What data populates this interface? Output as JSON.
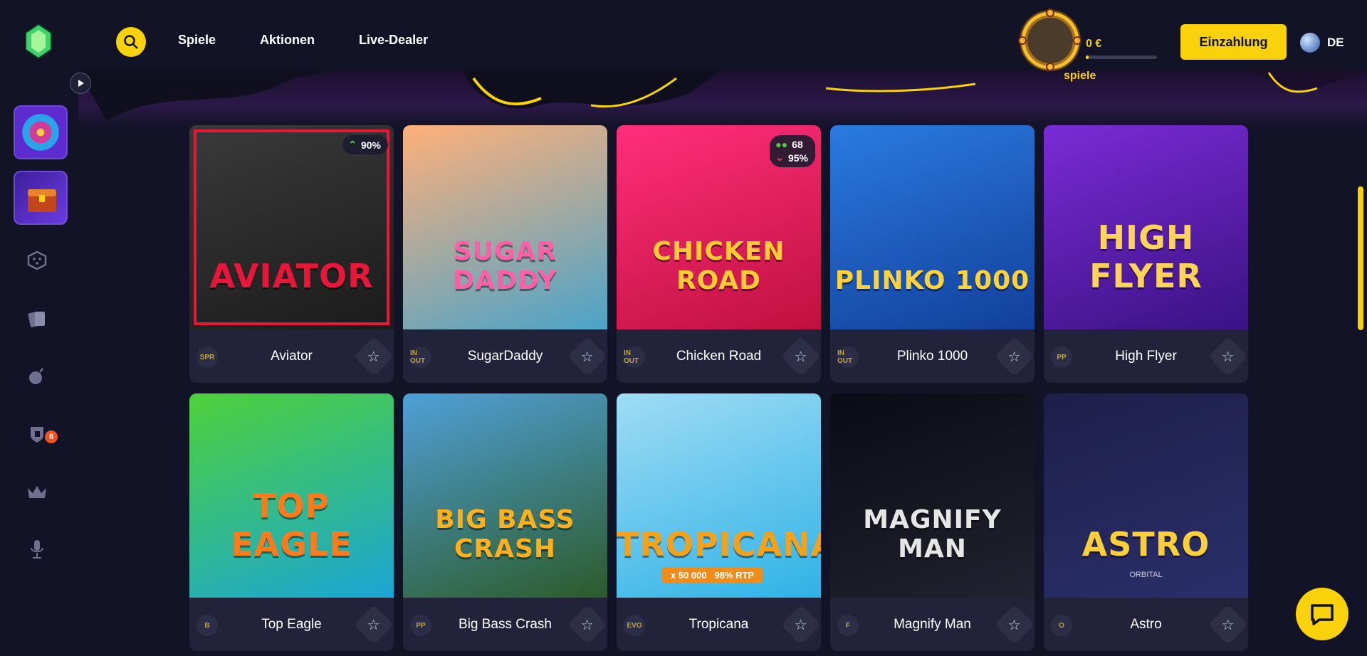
{
  "header": {
    "nav": [
      "Spiele",
      "Aktionen",
      "Live-Dealer"
    ],
    "balance": "0 €",
    "balance_progress": 0.04,
    "deposit_label": "Einzahlung",
    "language": "DE"
  },
  "sidebar": {
    "icons": [
      "wheel-of-fortune-tile",
      "treasure-chest-tile",
      "dice-icon",
      "cards-icon",
      "bomb-icon",
      "shield-icon",
      "crown-icon",
      "microphone-icon"
    ],
    "bomb_badge": "6"
  },
  "banner": {
    "partial_label": "spiele"
  },
  "games": [
    {
      "name": "Aviator",
      "provider": "SPR",
      "rtp": "90%",
      "art": "AVIATOR",
      "colors": [
        "#3a3a3a",
        "#1b1b1b"
      ],
      "accent": "#e8173a"
    },
    {
      "name": "SugarDaddy",
      "provider": "IN OUT",
      "art": "SUGAR DADDY",
      "colors": [
        "#ffb07a",
        "#4aa3c9"
      ],
      "accent": "#ff5fa8"
    },
    {
      "name": "Chicken Road",
      "provider": "IN OUT",
      "players": "68",
      "rtp": "95%",
      "art": "CHICKEN ROAD",
      "colors": [
        "#ff2f7a",
        "#c0103f"
      ],
      "accent": "#ffcc33"
    },
    {
      "name": "Plinko 1000",
      "provider": "IN OUT",
      "art": "PLINKO 1000",
      "colors": [
        "#2a7be0",
        "#123f9b"
      ],
      "accent": "#ffd23b"
    },
    {
      "name": "High Flyer",
      "provider": "PP",
      "art": "HIGH FLYER",
      "colors": [
        "#7b2bd6",
        "#3a1283"
      ],
      "accent": "#ffd35a"
    },
    {
      "name": "Top Eagle",
      "provider": "B",
      "art": "TOP EAGLE",
      "colors": [
        "#4ed13a",
        "#1aa5d6"
      ],
      "accent": "#ff7a1a"
    },
    {
      "name": "Big Bass Crash",
      "provider": "PP",
      "art": "BIG BASS CRASH",
      "colors": [
        "#4fa0d8",
        "#2c5b2a"
      ],
      "accent": "#ffb01c"
    },
    {
      "name": "Tropicana",
      "provider": "EVO",
      "art": "TROPICANA",
      "badge": "x 50 000   98% RTP",
      "colors": [
        "#9fdcf5",
        "#2fb2e6"
      ],
      "accent": "#f5a21a"
    },
    {
      "name": "Magnify Man",
      "provider": "F",
      "art": "MAGNIFY MAN",
      "colors": [
        "#0b0b14",
        "#222230"
      ],
      "accent": "#e6e6e6"
    },
    {
      "name": "Astro",
      "provider": "O",
      "art": "ASTRO",
      "subtitle": "ORBITAL",
      "colors": [
        "#1d1f4a",
        "#2a2f6b"
      ],
      "accent": "#ffcf3a"
    }
  ]
}
